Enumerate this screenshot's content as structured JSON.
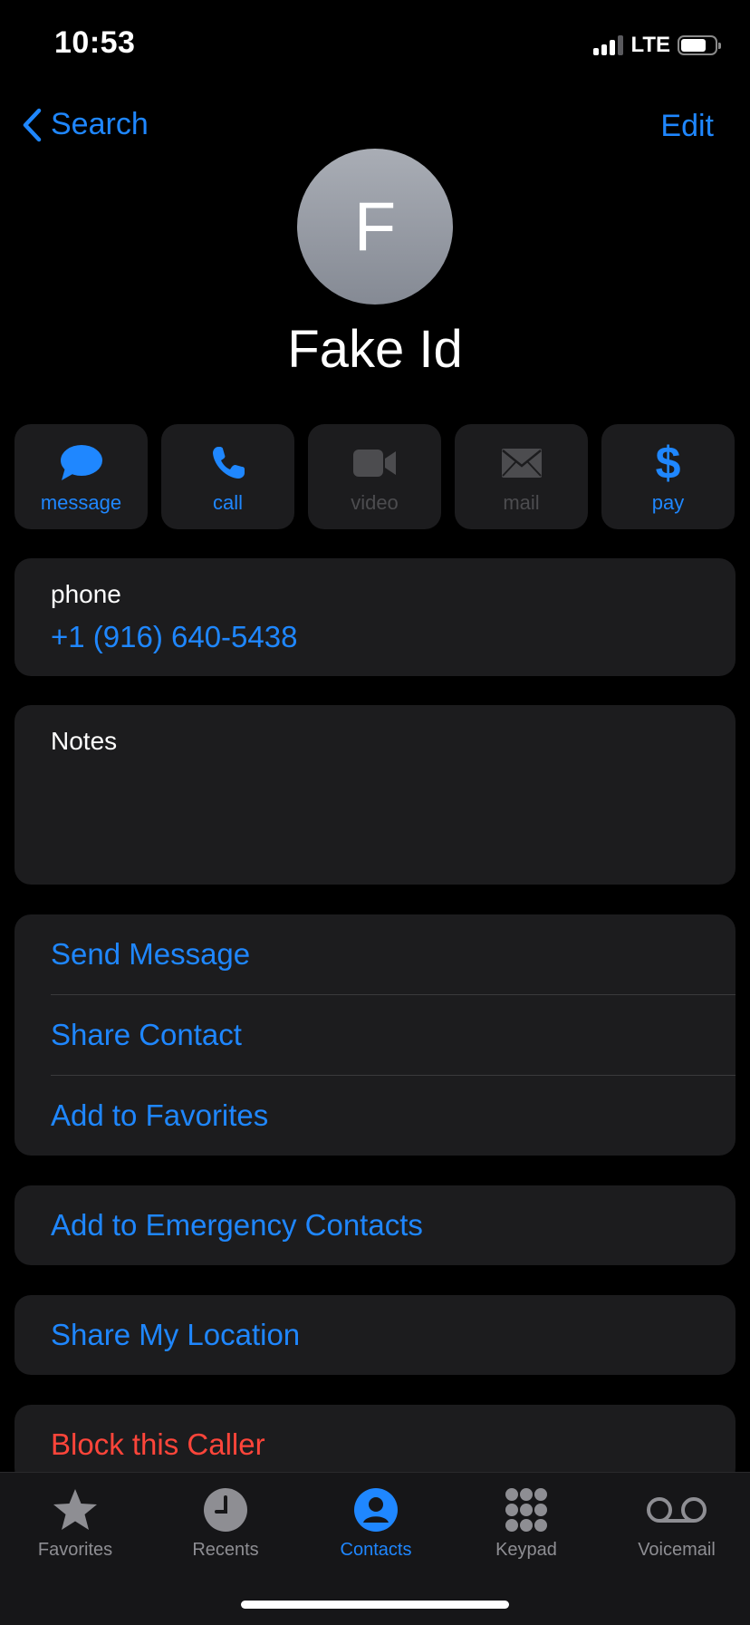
{
  "status_bar": {
    "time": "10:53",
    "network": "LTE"
  },
  "nav": {
    "back_label": "Search",
    "edit_label": "Edit"
  },
  "contact": {
    "initial": "F",
    "name": "Fake Id"
  },
  "actions": [
    {
      "label": "message",
      "icon": "message-bubble-icon",
      "enabled": true
    },
    {
      "label": "call",
      "icon": "phone-icon",
      "enabled": true
    },
    {
      "label": "video",
      "icon": "video-camera-icon",
      "enabled": false
    },
    {
      "label": "mail",
      "icon": "envelope-icon",
      "enabled": false
    },
    {
      "label": "pay",
      "icon": "dollar-icon",
      "enabled": true
    }
  ],
  "phone": {
    "label": "phone",
    "number": "+1 (916) 640-5438"
  },
  "notes": {
    "label": "Notes"
  },
  "options": {
    "send_message": "Send Message",
    "share_contact": "Share Contact",
    "add_favorites": "Add to Favorites",
    "emergency": "Add to Emergency Contacts",
    "share_location": "Share My Location",
    "block": "Block this Caller"
  },
  "tabs": [
    {
      "label": "Favorites",
      "icon": "star-icon"
    },
    {
      "label": "Recents",
      "icon": "clock-icon"
    },
    {
      "label": "Contacts",
      "icon": "person-icon",
      "active": true
    },
    {
      "label": "Keypad",
      "icon": "keypad-icon"
    },
    {
      "label": "Voicemail",
      "icon": "voicemail-icon"
    }
  ],
  "colors": {
    "accent": "#1f87ff",
    "destructive": "#ff453a",
    "card": "#1c1c1e"
  }
}
